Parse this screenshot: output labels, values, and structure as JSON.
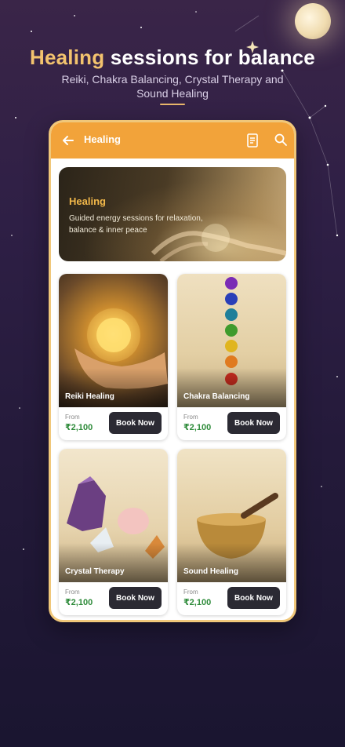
{
  "promo": {
    "title_accent": "Healing",
    "title_rest": "sessions for balance",
    "subtitle": "Reiki, Chakra Balancing, Crystal Therapy and Sound Healing"
  },
  "appbar": {
    "title": "Healing",
    "back_icon": "arrow-left-icon",
    "book_icon": "book-icon",
    "search_icon": "search-icon"
  },
  "hero": {
    "title": "Healing",
    "description": "Guided energy sessions for relaxation, balance & inner peace"
  },
  "services": [
    {
      "name": "Reiki Healing",
      "from_label": "From",
      "price": "₹2,100",
      "button": "Book Now"
    },
    {
      "name": "Chakra Balancing",
      "from_label": "From",
      "price": "₹2,100",
      "button": "Book Now"
    },
    {
      "name": "Crystal Therapy",
      "from_label": "From",
      "price": "₹2,100",
      "button": "Book Now"
    },
    {
      "name": "Sound Healing",
      "from_label": "From",
      "price": "₹2,100",
      "button": "Book Now"
    }
  ],
  "colors": {
    "accent": "#f2a33a",
    "title_accent": "#f3c36e",
    "price": "#2e8b3a",
    "button": "#2b2a33"
  }
}
